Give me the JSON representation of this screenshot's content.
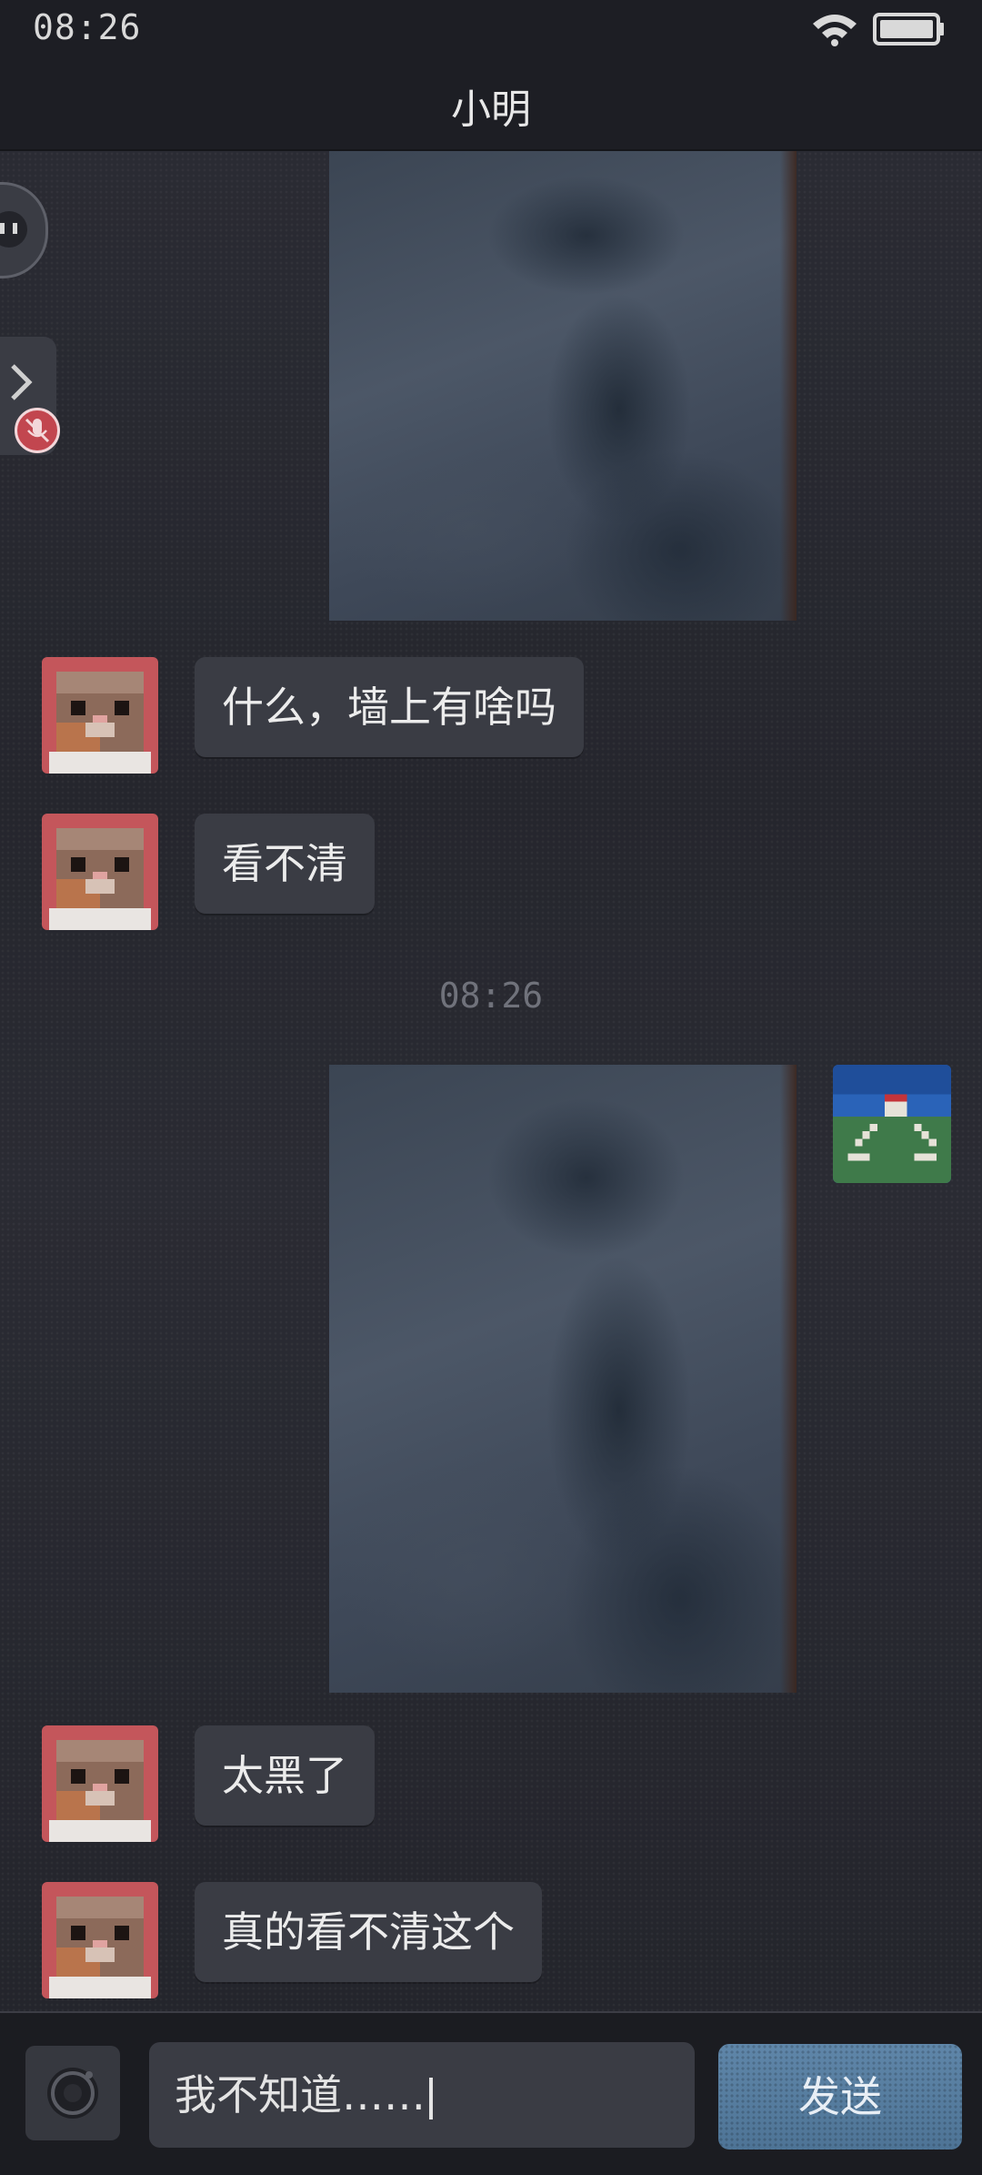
{
  "status_bar": {
    "time": "08:26",
    "wifi_icon": "wifi-icon",
    "battery_icon": "battery-icon"
  },
  "header": {
    "title": "小明"
  },
  "messages": [
    {
      "sender": "other",
      "type": "text",
      "text": "什么，墙上有啥吗"
    },
    {
      "sender": "other",
      "type": "text",
      "text": "看不清"
    },
    {
      "type": "timestamp",
      "text": "08:26"
    },
    {
      "sender": "me",
      "type": "image"
    },
    {
      "sender": "other",
      "type": "text",
      "text": "太黑了"
    },
    {
      "sender": "other",
      "type": "text",
      "text": "真的看不清这个"
    }
  ],
  "input": {
    "value": "我不知道……",
    "send_label": "发送",
    "camera_icon": "camera-icon"
  },
  "colors": {
    "background": "#24252c",
    "bubble": "#3a3c44",
    "send": "#5a7fa2",
    "avatar_red": "#c4565b"
  }
}
